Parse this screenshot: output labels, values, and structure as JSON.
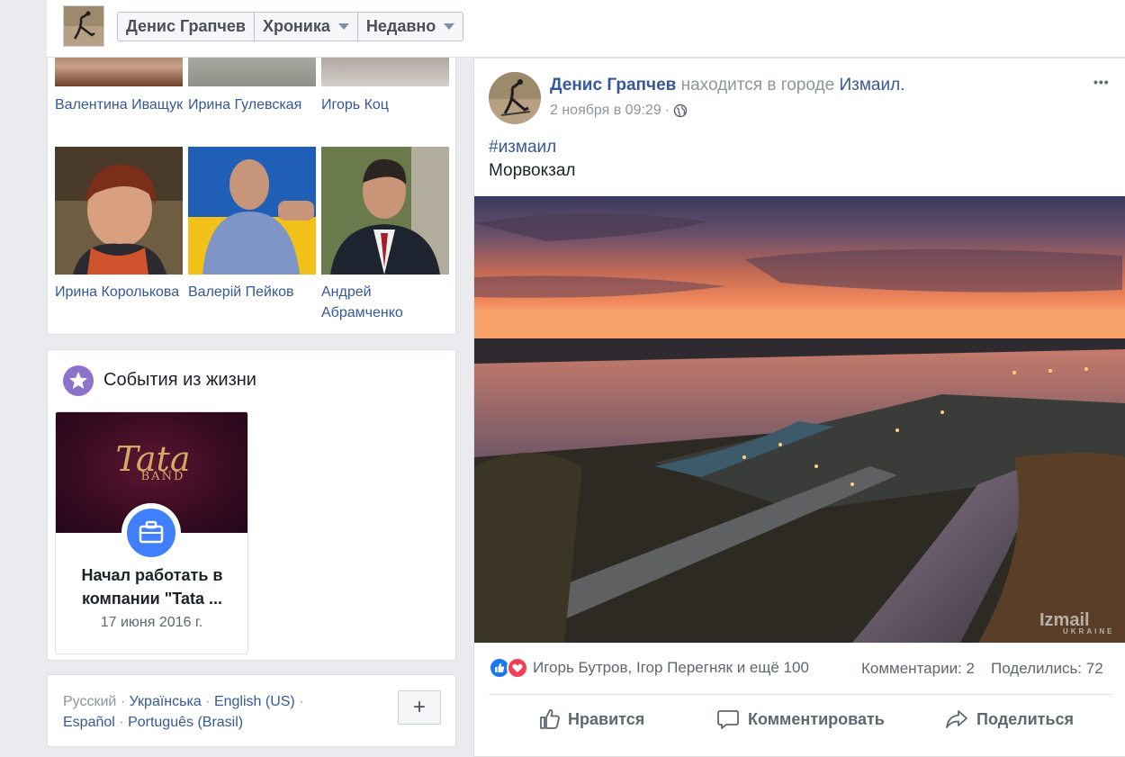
{
  "topbar": {
    "name_tab": "Денис Грапчев",
    "timeline_tab": "Хроника",
    "recent_tab": "Недавно"
  },
  "friends": [
    {
      "name": "Валентина Иващук"
    },
    {
      "name": "Ирина Гулевская"
    },
    {
      "name": "Игорь Коц"
    },
    {
      "name": "Ирина Королькова"
    },
    {
      "name": "Валерій Пейков"
    },
    {
      "name": "Андрей Абрамченко"
    }
  ],
  "life_events": {
    "title": "События из жизни",
    "event_title": "Начал работать в компании \"Tata ...",
    "event_date": "17 июня 2016 г.",
    "logo_text": "Tata",
    "logo_sub": "BAND"
  },
  "languages": {
    "ru": "Русский",
    "uk": "Українська",
    "en": "English (US)",
    "es": "Español",
    "pt": "Português (Brasil)",
    "sep": "·",
    "add_label": "+"
  },
  "post": {
    "author": "Денис Грапчев",
    "location_prefix": "находится в городе",
    "location": "Измаил.",
    "timestamp": "2 ноября в 09:29",
    "separator": "·",
    "more": "•••",
    "hashtag": "#измаил",
    "text": "Морвокзал",
    "watermark": "Izmail",
    "watermark_sub": "UKRAINE",
    "reactions_text": "Игорь Бутров, Ігор Перегняк и ещё 100",
    "comments_text": "Комментарии: 2",
    "shares_text": "Поделились: 72",
    "like_label": "Нравится",
    "comment_label": "Комментировать",
    "share_label": "Поделиться"
  },
  "colors": {
    "link": "#365899",
    "brand_blue": "#4267b2",
    "like_blue": "#1877f2",
    "love_red": "#f33e58",
    "life_purple": "#8c72cb",
    "page_bg": "#e9ebee"
  }
}
